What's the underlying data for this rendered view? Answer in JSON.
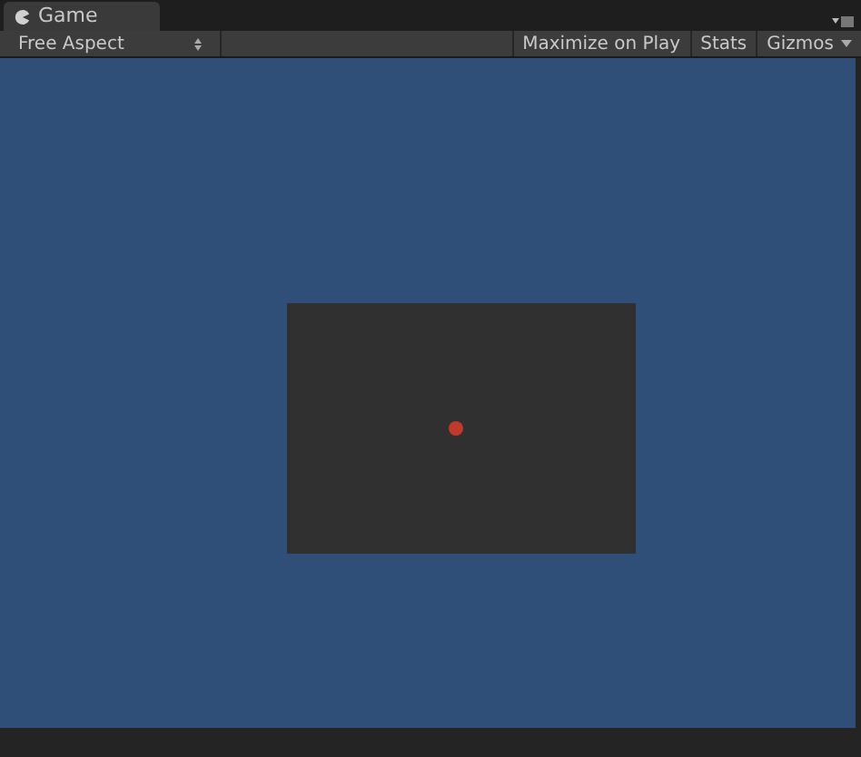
{
  "tab": {
    "label": "Game"
  },
  "toolbar": {
    "aspect_dropdown": "Free Aspect",
    "buttons": [
      "Maximize on Play",
      "Stats",
      "Gizmos"
    ]
  }
}
